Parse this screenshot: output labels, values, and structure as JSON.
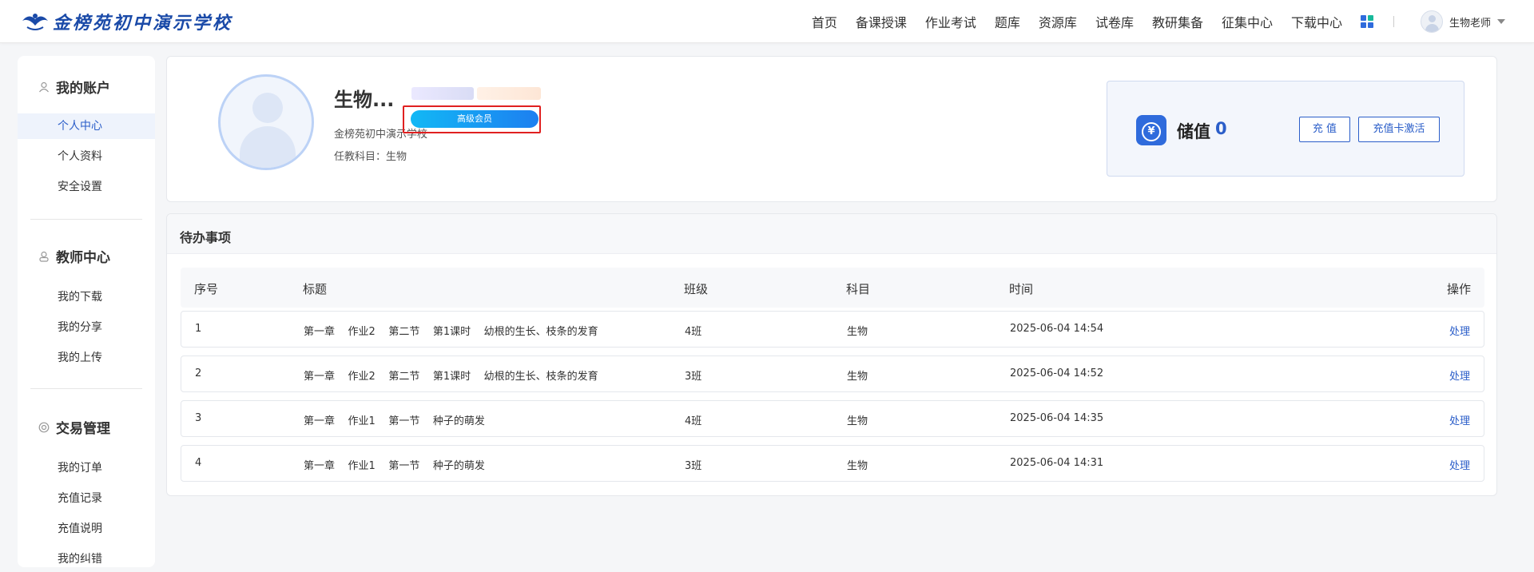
{
  "header": {
    "logo_text": "金榜苑初中演示学校",
    "nav": [
      "首页",
      "备课授课",
      "作业考试",
      "题库",
      "资源库",
      "试卷库",
      "教研集备",
      "征集中心",
      "下载中心"
    ],
    "user_name": "生物老师"
  },
  "sidebar": {
    "groups": [
      {
        "title": "我的账户",
        "icon": "user-icon",
        "items": [
          "个人中心",
          "个人资料",
          "安全设置"
        ]
      },
      {
        "title": "教师中心",
        "icon": "teacher-icon",
        "items": [
          "我的下载",
          "我的分享",
          "我的上传"
        ]
      },
      {
        "title": "交易管理",
        "icon": "trade-icon",
        "items": [
          "我的订单",
          "充值记录",
          "充值说明",
          "我的纠错"
        ]
      }
    ],
    "active_item": "个人中心"
  },
  "profile": {
    "name": "生物...",
    "member_badge": "高级会员",
    "school": "金榜苑初中演示学校",
    "subject": "任教科目：生物"
  },
  "balance": {
    "label": "储值",
    "value": "0",
    "recharge_button": "充 值",
    "activate_button": "充值卡激活"
  },
  "todo": {
    "title": "待办事项",
    "columns": [
      "序号",
      "标题",
      "班级",
      "科目",
      "时间",
      "操作"
    ],
    "rows": [
      {
        "no": "1",
        "title": "第一章    作业2    第二节    第1课时    幼根的生长、枝条的发育",
        "class": "4班",
        "subject": "生物",
        "time": "2025-06-04 14:54",
        "action": "处理"
      },
      {
        "no": "2",
        "title": "第一章    作业2    第二节    第1课时    幼根的生长、枝条的发育",
        "class": "3班",
        "subject": "生物",
        "time": "2025-06-04 14:52",
        "action": "处理"
      },
      {
        "no": "3",
        "title": "第一章    作业1    第一节    种子的萌发",
        "class": "4班",
        "subject": "生物",
        "time": "2025-06-04 14:35",
        "action": "处理"
      },
      {
        "no": "4",
        "title": "第一章    作业1    第一节    种子的萌发",
        "class": "3班",
        "subject": "生物",
        "time": "2025-06-04 14:31",
        "action": "处理"
      }
    ]
  },
  "colors": {
    "accent": "#2b5ec9",
    "highlight_box": "#e02020",
    "badge_gradient_start": "#12b8f5",
    "badge_gradient_end": "#1d7ff0"
  }
}
